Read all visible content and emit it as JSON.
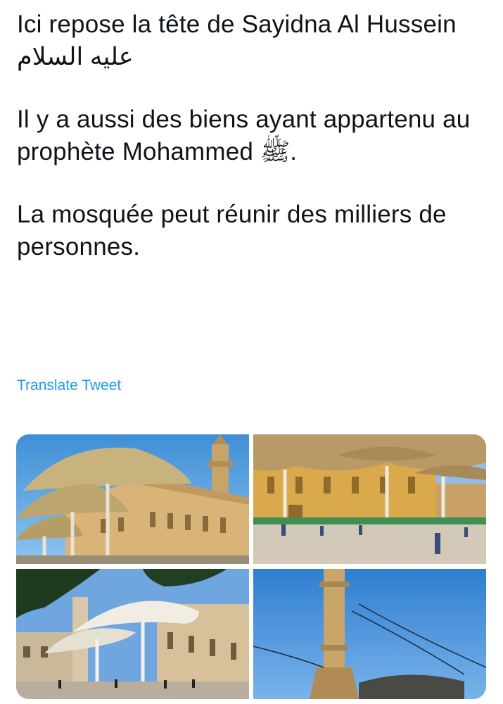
{
  "tweet": {
    "paragraphs": [
      "Ici repose la tête de Sayidna Al Hussein عليه السلام",
      "Il y a aussi des biens ayant appartenu au prophète Mohammed ﷺ.",
      "La mosquée peut réunir des milliers de personnes."
    ],
    "translate_label": "Translate Tweet"
  },
  "media": {
    "photos": [
      {
        "icon": "mosque-umbrellas-photo"
      },
      {
        "icon": "mosque-plaza-photo"
      },
      {
        "icon": "mosque-white-umbrellas-photo"
      },
      {
        "icon": "minaret-photo"
      }
    ]
  }
}
